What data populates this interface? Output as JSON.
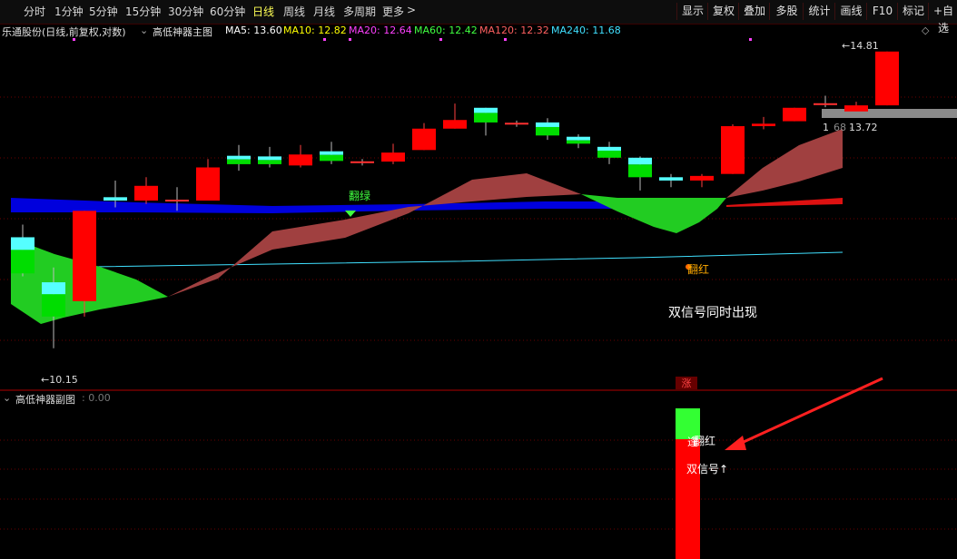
{
  "toolbar": {
    "periods": [
      "分时",
      "1分钟",
      "5分钟",
      "15分钟",
      "30分钟",
      "60分钟",
      "日线",
      "周线",
      "月线",
      "多周期",
      "更多"
    ],
    "active_period": "日线",
    "more_arrow": ">",
    "right_buttons": [
      "显示",
      "复权",
      "叠加",
      "多股",
      "统计",
      "画线",
      "F10",
      "标记",
      "+自选"
    ]
  },
  "main_info": {
    "stock": "乐通股份(日线,前复权,对数)",
    "indicator": "高低神器主图",
    "ma": [
      {
        "label": "MA5: 13.60",
        "color": "#ffffff"
      },
      {
        "label": "MA10: 12.82",
        "color": "#ffff00"
      },
      {
        "label": "MA20: 12.64",
        "color": "#ff40ff"
      },
      {
        "label": "MA60: 12.42",
        "color": "#40ff40"
      },
      {
        "label": "MA120: 12.32",
        "color": "#ff6060"
      },
      {
        "label": "MA240: 11.68",
        "color": "#40e0ff"
      }
    ]
  },
  "sub_info": {
    "indicator": "高低神器副图",
    "value": ": 0.00"
  },
  "annotations": {
    "high_label": "14.81",
    "low_label": "10.15",
    "mid_label": "13.72",
    "mid_label_prefix": "1",
    "mid_label_obscured": "68 -",
    "flip_green": "翻绿",
    "flip_red": "翻红",
    "dual_signal_text": "双信号同时出现",
    "zhang_badge": "涨",
    "sub_label_1": "翻红",
    "sub_label_1_overlap": "逢",
    "sub_label_2": "双信号↑"
  },
  "colors": {
    "up": "#ff0000",
    "down": "#00dd00",
    "doji": "#55ffff",
    "ma60": "#0000dd",
    "ma240": "#40e0ff",
    "green_cloud": "#22cc22",
    "red_cloud": "#a04040",
    "grid": "#6a0000",
    "arrow": "#ff2020"
  },
  "chart_data": {
    "type": "candlestick",
    "price_range": [
      10.0,
      15.0
    ],
    "y_scale": "log",
    "candles": [
      {
        "o": 11.87,
        "c": 11.37,
        "h": 12.05,
        "l": 11.33
      },
      {
        "o": 11.25,
        "c": 10.8,
        "h": 11.45,
        "l": 10.4
      },
      {
        "o": 11.0,
        "c": 12.25,
        "h": 12.25,
        "l": 10.8
      },
      {
        "o": 12.45,
        "c": 12.4,
        "h": 12.7,
        "l": 12.3
      },
      {
        "o": 12.4,
        "c": 12.62,
        "h": 12.75,
        "l": 12.35
      },
      {
        "o": 12.4,
        "c": 12.4,
        "h": 12.6,
        "l": 12.25
      },
      {
        "o": 12.4,
        "c": 12.9,
        "h": 13.03,
        "l": 12.4
      },
      {
        "o": 13.08,
        "c": 12.95,
        "h": 13.25,
        "l": 12.85
      },
      {
        "o": 13.07,
        "c": 12.95,
        "h": 13.22,
        "l": 12.9
      },
      {
        "o": 12.93,
        "c": 13.1,
        "h": 13.25,
        "l": 12.9
      },
      {
        "o": 13.15,
        "c": 13.0,
        "h": 13.3,
        "l": 12.95
      },
      {
        "o": 12.98,
        "c": 12.98,
        "h": 13.03,
        "l": 12.93
      },
      {
        "o": 12.99,
        "c": 13.13,
        "h": 13.27,
        "l": 12.95
      },
      {
        "o": 13.17,
        "c": 13.51,
        "h": 13.6,
        "l": 13.17
      },
      {
        "o": 13.51,
        "c": 13.65,
        "h": 13.92,
        "l": 13.51
      },
      {
        "o": 13.85,
        "c": 13.61,
        "h": 13.85,
        "l": 13.4
      },
      {
        "o": 13.59,
        "c": 13.59,
        "h": 13.64,
        "l": 13.54
      },
      {
        "o": 13.61,
        "c": 13.4,
        "h": 13.68,
        "l": 13.33
      },
      {
        "o": 13.38,
        "c": 13.27,
        "h": 13.42,
        "l": 13.2
      },
      {
        "o": 13.22,
        "c": 13.05,
        "h": 13.3,
        "l": 12.95
      },
      {
        "o": 13.05,
        "c": 12.75,
        "h": 13.07,
        "l": 12.55
      },
      {
        "o": 12.75,
        "c": 12.7,
        "h": 12.8,
        "l": 12.6
      },
      {
        "o": 12.7,
        "c": 12.77,
        "h": 12.8,
        "l": 12.6
      },
      {
        "o": 12.8,
        "c": 13.55,
        "h": 13.58,
        "l": 12.8
      },
      {
        "o": 13.55,
        "c": 13.59,
        "h": 13.7,
        "l": 13.5
      },
      {
        "o": 13.63,
        "c": 13.85,
        "h": 13.85,
        "l": 13.63
      },
      {
        "o": 13.91,
        "c": 13.89,
        "h": 14.05,
        "l": 13.86
      },
      {
        "o": 13.79,
        "c": 13.89,
        "h": 13.95,
        "l": 13.79
      },
      {
        "o": 13.89,
        "c": 14.81,
        "h": 14.81,
        "l": 13.89
      }
    ]
  }
}
